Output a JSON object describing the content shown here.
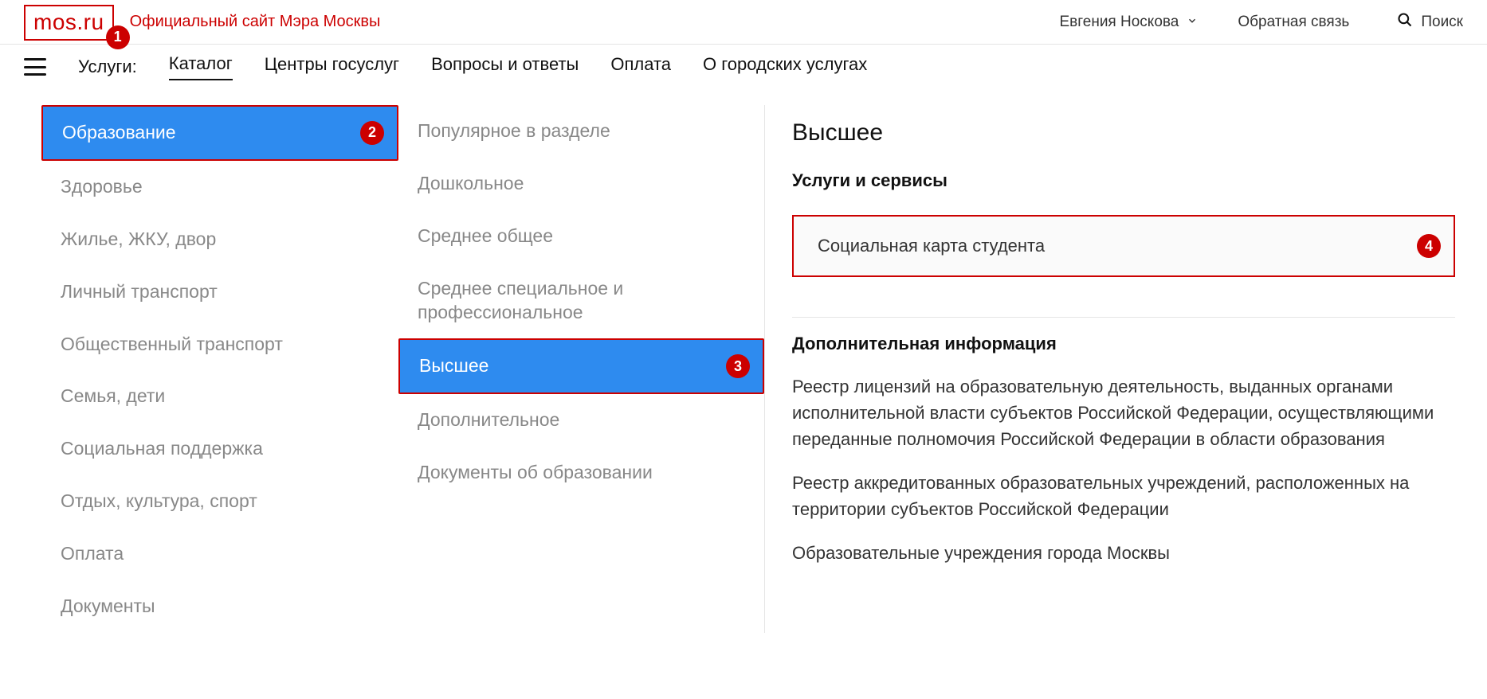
{
  "header": {
    "logo": "mos.ru",
    "subtitle": "Официальный сайт Мэра Москвы",
    "user_name": "Евгения Носкова",
    "feedback": "Обратная связь",
    "search": "Поиск"
  },
  "nav": {
    "services_label": "Услуги:",
    "items": [
      {
        "label": "Каталог",
        "active": true
      },
      {
        "label": "Центры госуслуг",
        "active": false
      },
      {
        "label": "Вопросы и ответы",
        "active": false
      },
      {
        "label": "Оплата",
        "active": false
      },
      {
        "label": "О городских услугах",
        "active": false
      }
    ]
  },
  "categories": [
    {
      "label": "Образование",
      "selected": true
    },
    {
      "label": "Здоровье"
    },
    {
      "label": "Жилье, ЖКУ, двор"
    },
    {
      "label": "Личный транспорт"
    },
    {
      "label": "Общественный транспорт"
    },
    {
      "label": "Семья, дети"
    },
    {
      "label": "Социальная поддержка"
    },
    {
      "label": "Отдых, культура, спорт"
    },
    {
      "label": "Оплата"
    },
    {
      "label": "Документы"
    }
  ],
  "subcategories": [
    {
      "label": "Популярное в разделе"
    },
    {
      "label": "Дошкольное"
    },
    {
      "label": "Среднее общее"
    },
    {
      "label": "Среднее специальное и профессиональное"
    },
    {
      "label": "Высшее",
      "selected": true
    },
    {
      "label": "Дополнительное"
    },
    {
      "label": "Документы об образовании"
    }
  ],
  "content": {
    "title": "Высшее",
    "services_heading": "Услуги и сервисы",
    "service_card": "Социальная карта студента",
    "info_heading": "Дополнительная информация",
    "info_paragraphs": [
      "Реестр лицензий на образовательную деятельность, выданных органами исполнительной власти субъектов Российской Федерации, осуществляющими переданные полномочия Российской Федерации в области образования",
      "Реестр аккредитованных образовательных учреждений, расположенных на территории субъектов Российской Федерации",
      "Образовательные учреждения города Москвы"
    ]
  },
  "badges": {
    "b1": "1",
    "b2": "2",
    "b3": "3",
    "b4": "4"
  }
}
